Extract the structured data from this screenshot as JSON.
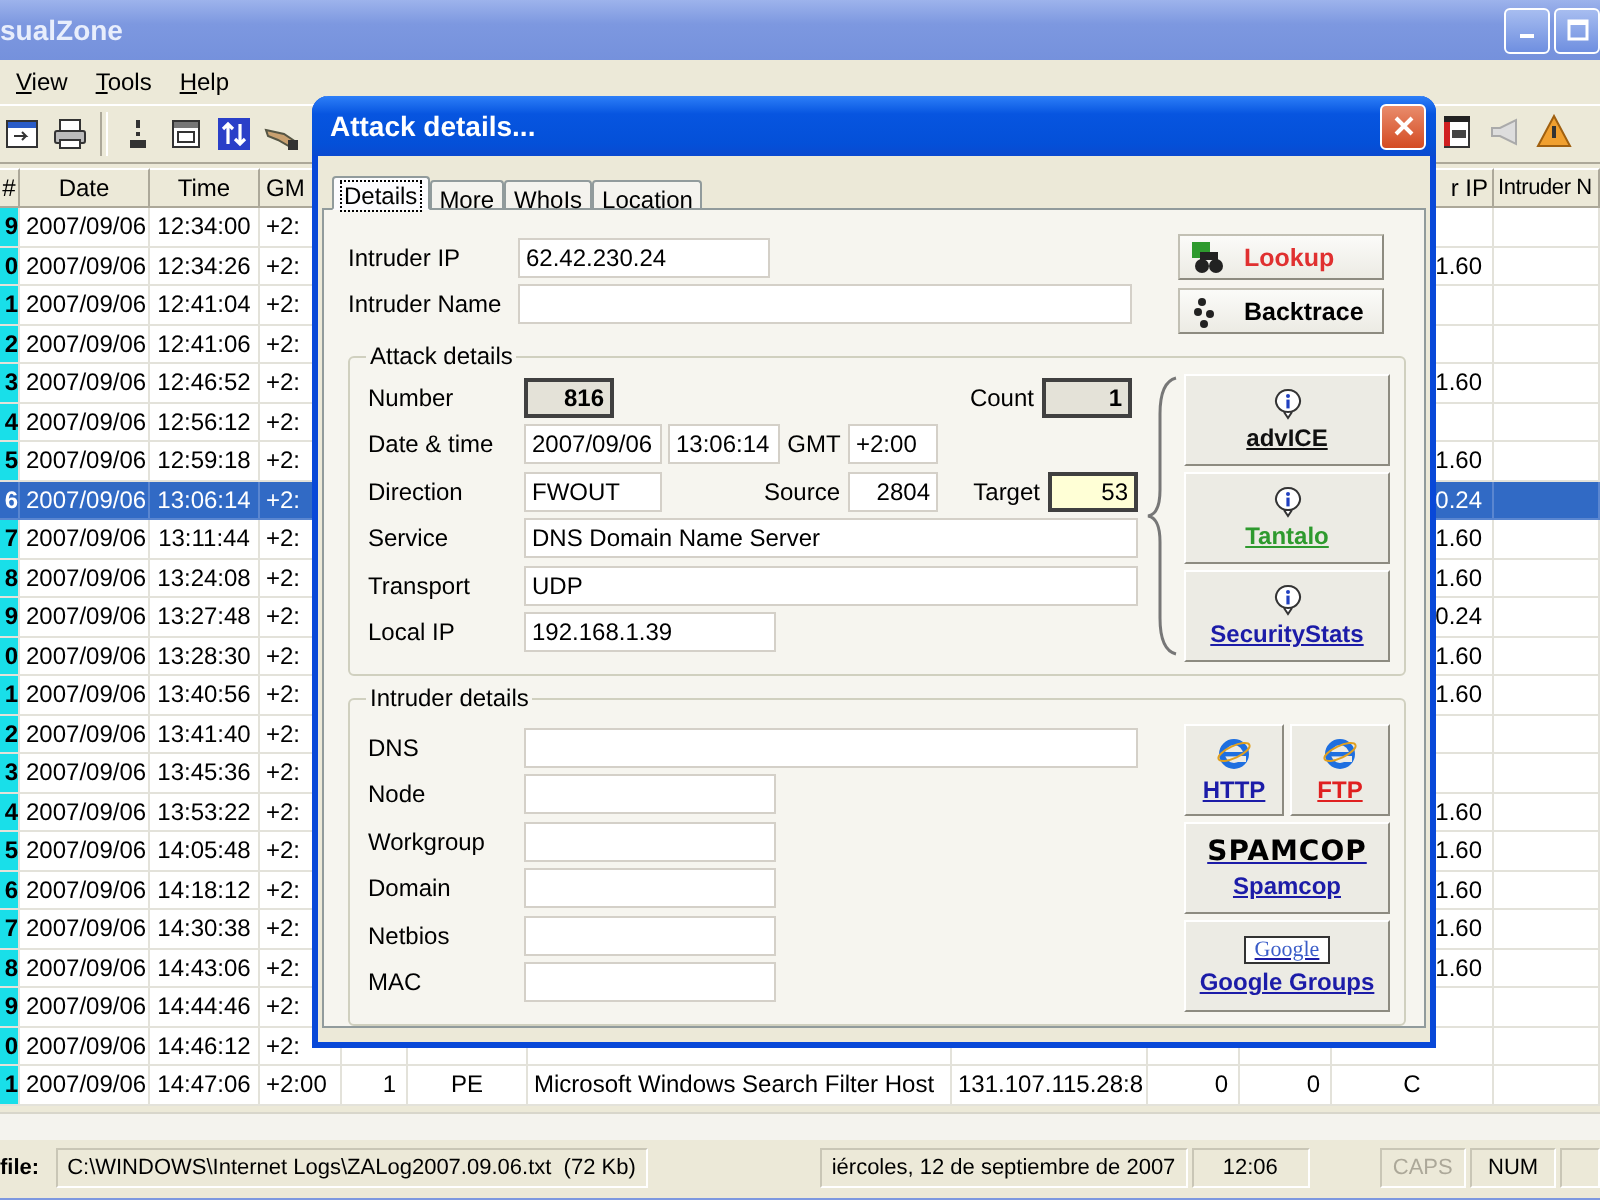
{
  "window": {
    "title": "sualZone"
  },
  "menu": [
    {
      "label": "View"
    },
    {
      "label": "Tools"
    },
    {
      "label": "Help"
    }
  ],
  "table": {
    "columns": [
      "#",
      "Date",
      "Time",
      "GM",
      "r IP",
      "Intruder N"
    ],
    "rows": [
      {
        "number": "9",
        "date": "2007/09/06",
        "time": "12:34:00",
        "gmt": "+2:",
        "selected": false
      },
      {
        "number": "0",
        "date": "2007/09/06",
        "time": "12:34:26",
        "gmt": "+2:",
        "ip": "1.60",
        "selected": false
      },
      {
        "number": "1",
        "date": "2007/09/06",
        "time": "12:41:04",
        "gmt": "+2:",
        "selected": false
      },
      {
        "number": "2",
        "date": "2007/09/06",
        "time": "12:41:06",
        "gmt": "+2:",
        "selected": false
      },
      {
        "number": "3",
        "date": "2007/09/06",
        "time": "12:46:52",
        "gmt": "+2:",
        "ip": "1.60",
        "selected": false
      },
      {
        "number": "4",
        "date": "2007/09/06",
        "time": "12:56:12",
        "gmt": "+2:",
        "selected": false
      },
      {
        "number": "5",
        "date": "2007/09/06",
        "time": "12:59:18",
        "gmt": "+2:",
        "ip": "1.60",
        "selected": false
      },
      {
        "number": "6",
        "date": "2007/09/06",
        "time": "13:06:14",
        "gmt": "+2:",
        "ip": "0.24",
        "selected": true
      },
      {
        "number": "7",
        "date": "2007/09/06",
        "time": "13:11:44",
        "gmt": "+2:",
        "ip": "1.60",
        "selected": false
      },
      {
        "number": "8",
        "date": "2007/09/06",
        "time": "13:24:08",
        "gmt": "+2:",
        "ip": "1.60",
        "selected": false
      },
      {
        "number": "9",
        "date": "2007/09/06",
        "time": "13:27:48",
        "gmt": "+2:",
        "ip": "0.24",
        "selected": false
      },
      {
        "number": "0",
        "date": "2007/09/06",
        "time": "13:28:30",
        "gmt": "+2:",
        "ip": "1.60",
        "selected": false
      },
      {
        "number": "1",
        "date": "2007/09/06",
        "time": "13:40:56",
        "gmt": "+2:",
        "ip": "1.60",
        "selected": false
      },
      {
        "number": "2",
        "date": "2007/09/06",
        "time": "13:41:40",
        "gmt": "+2:",
        "selected": false
      },
      {
        "number": "3",
        "date": "2007/09/06",
        "time": "13:45:36",
        "gmt": "+2:",
        "selected": false
      },
      {
        "number": "4",
        "date": "2007/09/06",
        "time": "13:53:22",
        "gmt": "+2:",
        "ip": "1.60",
        "selected": false
      },
      {
        "number": "5",
        "date": "2007/09/06",
        "time": "14:05:48",
        "gmt": "+2:",
        "ip": "1.60",
        "selected": false
      },
      {
        "number": "6",
        "date": "2007/09/06",
        "time": "14:18:12",
        "gmt": "+2:",
        "ip": "1.60",
        "selected": false
      },
      {
        "number": "7",
        "date": "2007/09/06",
        "time": "14:30:38",
        "gmt": "+2:",
        "ip": "1.60",
        "selected": false
      },
      {
        "number": "8",
        "date": "2007/09/06",
        "time": "14:43:06",
        "gmt": "+2:",
        "ip": "1.60",
        "selected": false
      },
      {
        "number": "9",
        "date": "2007/09/06",
        "time": "14:44:46",
        "gmt": "+2:",
        "selected": false
      },
      {
        "number": "0",
        "date": "2007/09/06",
        "time": "14:46:12",
        "gmt": "+2:",
        "selected": false
      },
      {
        "number": "1",
        "date": "2007/09/06",
        "time": "14:47:06",
        "gmt": "+2:00",
        "column_5": "1",
        "column_6": "PE",
        "column_7": "Microsoft Windows Search Filter Host",
        "column_8": "131.107.115.28:8",
        "column_9": "0",
        "column_10": "0",
        "column_11": "C",
        "selected": false
      }
    ]
  },
  "status_bar": {
    "label": "file:",
    "path": "C:\\WINDOWS\\Internet Logs\\ZALog2007.09.06.txt  (72 Kb)",
    "date": "iércoles, 12 de septiembre de 2007",
    "time": "12:06",
    "caps": {
      "label": "CAPS",
      "on": false
    },
    "num": {
      "label": "NUM",
      "on": true
    }
  },
  "dialog": {
    "title": "Attack details...",
    "tabs": [
      {
        "label": "Details",
        "selected": true
      },
      {
        "label": "More",
        "selected": false
      },
      {
        "label": "WhoIs",
        "selected": false
      },
      {
        "label": "Location",
        "selected": false
      }
    ],
    "intruder_ip": {
      "label": "Intruder IP",
      "value": "62.42.230.24"
    },
    "intruder_name": {
      "label": "Intruder Name"
    },
    "lookup_button": {
      "label": "Lookup"
    },
    "backtrace_button": {
      "label": "Backtrace"
    },
    "attack_details": {
      "title": "Attack details",
      "number": {
        "label": "Number",
        "value": "816"
      },
      "count": {
        "label": "Count",
        "value": "1"
      },
      "date_time": {
        "label": "Date & time",
        "date": "2007/09/06",
        "time": "13:06:14"
      },
      "gmt": {
        "label": "GMT",
        "value": "+2:00"
      },
      "direction": {
        "label": "Direction",
        "value": "FWOUT"
      },
      "source": {
        "label": "Source",
        "value": "2804"
      },
      "target": {
        "label": "Target",
        "value": "53",
        "highlighted": true
      },
      "service": {
        "label": "Service",
        "value": "DNS Domain Name Server"
      },
      "transport": {
        "label": "Transport",
        "value": "UDP"
      },
      "local_ip": {
        "label": "Local IP",
        "value": "192.168.1.39"
      },
      "links": [
        {
          "label": "advICE",
          "color": "#111111"
        },
        {
          "label": "Tantalo",
          "color": "#2e9a2e"
        },
        {
          "label": "SecurityStats",
          "color": "#1c1ca8"
        }
      ]
    },
    "intruder_details": {
      "title": "Intruder details",
      "fields": [
        {
          "label": "DNS"
        },
        {
          "label": "Node"
        },
        {
          "label": "Workgroup"
        },
        {
          "label": "Domain"
        },
        {
          "label": "Netbios"
        },
        {
          "label": "MAC"
        }
      ],
      "links": [
        {
          "kind": "browser",
          "label": "HTTP",
          "color": "#1c1ca8"
        },
        {
          "kind": "browser",
          "label": "FTP",
          "color": "#e02020"
        },
        {
          "kind": "spamcop",
          "logo": "SPAMCOP",
          "label": "Spamcop",
          "color": "#1c1ca8"
        },
        {
          "kind": "google",
          "logo": "Google",
          "label": "Google Groups",
          "color": "#1c1ca8"
        }
      ]
    }
  }
}
